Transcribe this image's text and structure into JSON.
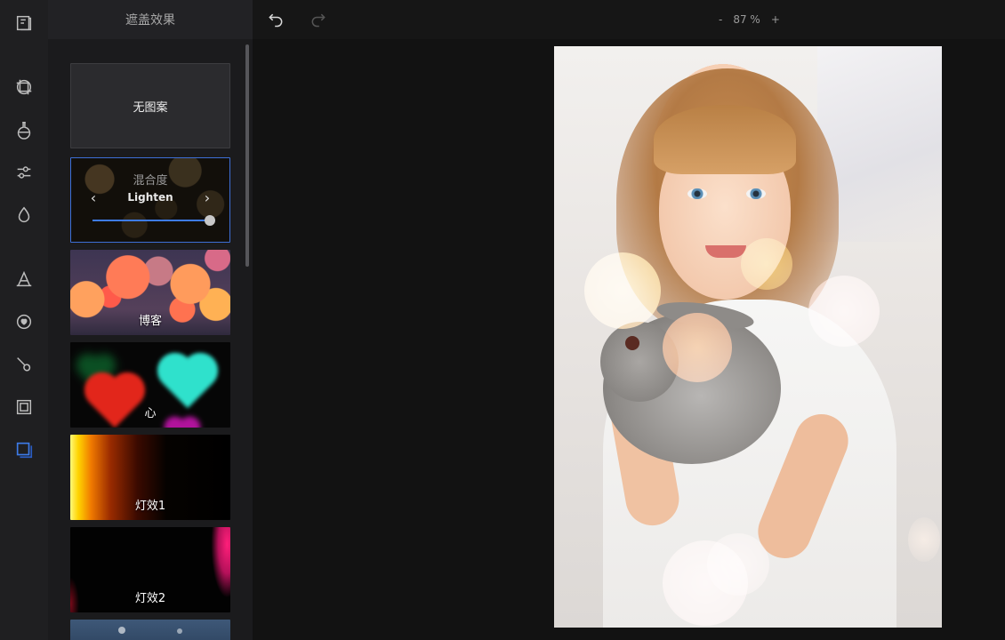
{
  "panel": {
    "title": "遮盖效果",
    "tiles": [
      {
        "label": "无图案"
      },
      {
        "label": "博客"
      },
      {
        "label": "心"
      },
      {
        "label": "灯效1"
      },
      {
        "label": "灯效2"
      }
    ],
    "blend": {
      "title": "混合度",
      "mode": "Lighten",
      "level": 1.0
    }
  },
  "toolbar": {
    "zoom_minus": "-",
    "zoom_value": "87 %",
    "zoom_plus": "+"
  },
  "rail": {
    "icons": [
      "document-icon",
      "crop-icon",
      "flask-icon",
      "adjust-sliders-icon",
      "drop-icon",
      "text-icon",
      "sticker-icon",
      "brush-icon",
      "frame-icon",
      "overlay-icon"
    ],
    "active_icon": "overlay-icon",
    "accent": "#3d7be8"
  }
}
